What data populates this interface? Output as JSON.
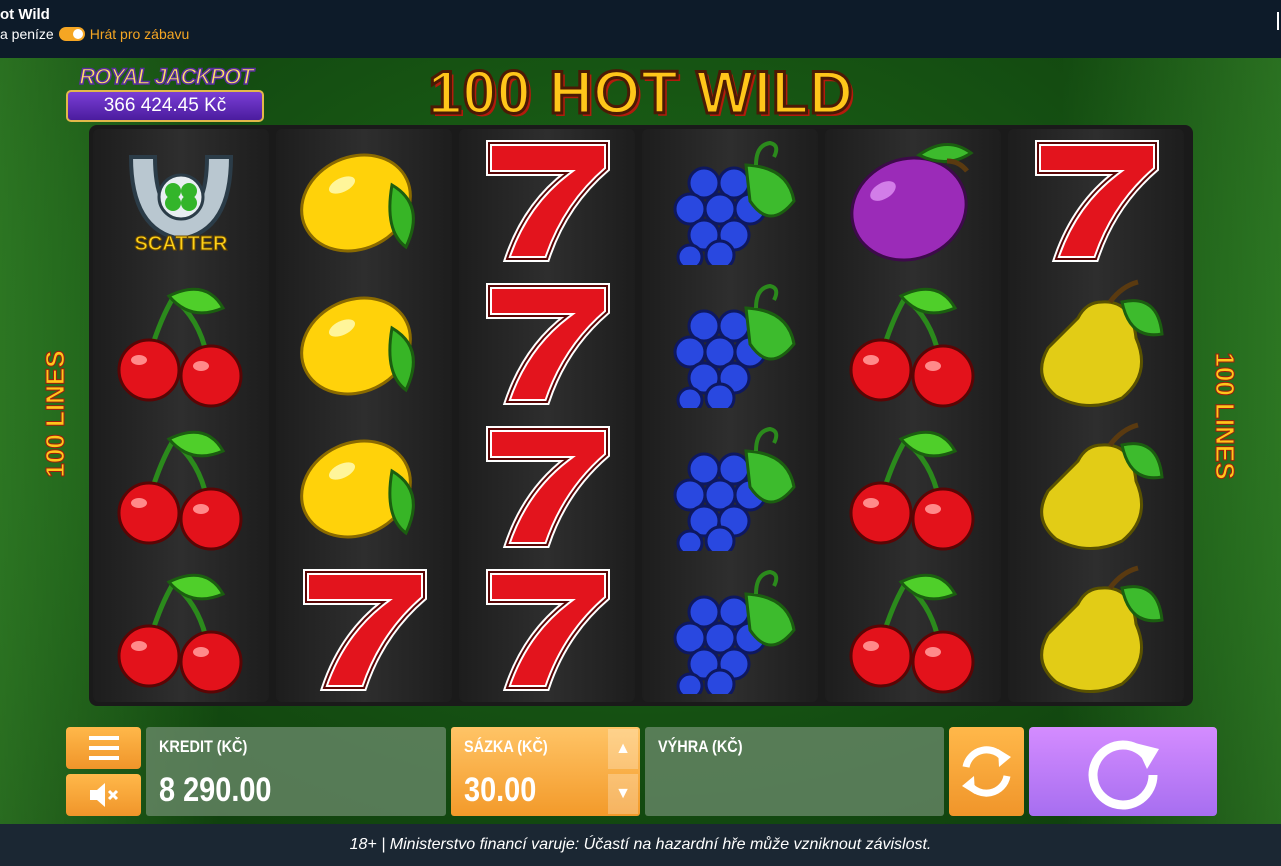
{
  "window": {
    "title": "ot Wild",
    "real_money_label": "a peníze",
    "play_for_fun_label": "Hrát pro zábavu"
  },
  "jackpot": {
    "title": "ROYAL JACKPOT",
    "value": "366 424.45 Kč"
  },
  "game": {
    "logo": "100 HOT WILD",
    "lines_label": "100 LINES",
    "scatter_label": "SCATTER"
  },
  "reels": [
    [
      "scatter",
      "cherry",
      "cherry",
      "cherry"
    ],
    [
      "lemon",
      "lemon",
      "lemon",
      "seven"
    ],
    [
      "seven",
      "seven",
      "seven",
      "seven"
    ],
    [
      "grapes",
      "grapes",
      "grapes",
      "grapes"
    ],
    [
      "plum",
      "cherry",
      "cherry",
      "cherry"
    ],
    [
      "seven",
      "pear",
      "pear",
      "pear"
    ]
  ],
  "controls": {
    "credit_label": "KREDIT (KČ)",
    "credit_value": "8 290.00",
    "bet_label": "SÁZKA (KČ)",
    "bet_value": "30.00",
    "win_label": "VÝHRA (KČ)",
    "win_value": ""
  },
  "footer": {
    "text": "18+ | Ministerstvo financí varuje: Účastí na hazardní hře může vzniknout závislost."
  },
  "colors": {
    "accent_orange": "#f5a623",
    "spin_purple": "#b27cf5",
    "reel_background": "#262626",
    "stage_green": "#1d6b17"
  },
  "icons": [
    "menu-icon",
    "sound-muted-icon",
    "autoplay-icon",
    "spin-icon",
    "fullscreen-icon",
    "arrow-up-icon",
    "arrow-down-icon"
  ]
}
